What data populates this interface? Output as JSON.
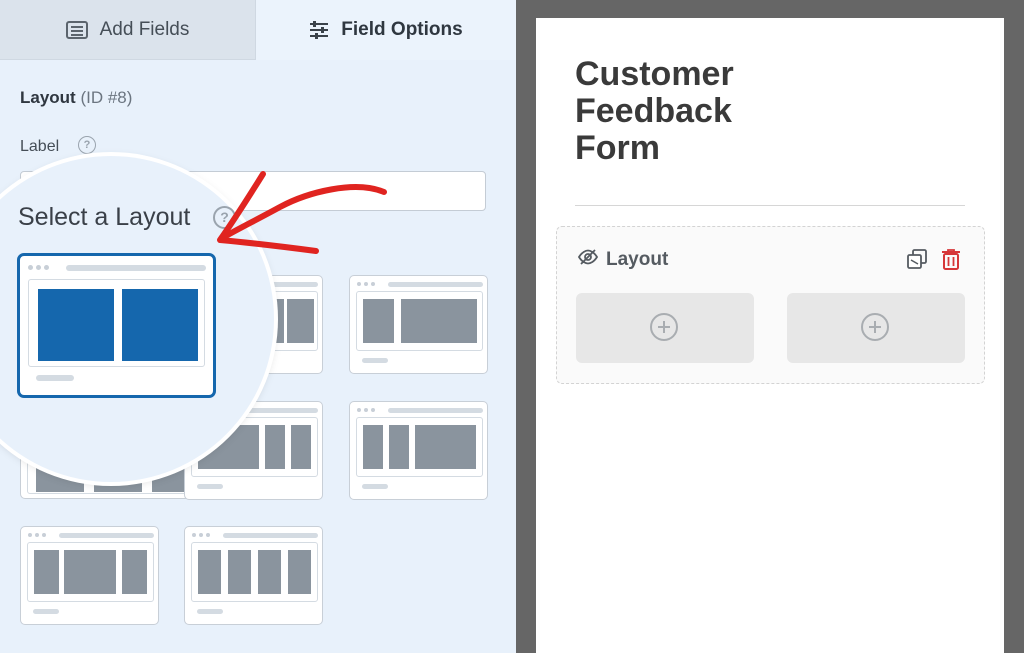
{
  "tabs": {
    "add_fields": "Add Fields",
    "field_options": "Field Options"
  },
  "field_options": {
    "title": "Layout",
    "id_text": "(ID #8)",
    "label": "Label",
    "help_icon": "?",
    "label_value": "",
    "select_layout": "Select a Layout",
    "selected_layout": "two equal columns"
  },
  "form": {
    "title_line1": "Customer",
    "title_line2": "Feedback",
    "title_line3": "Form",
    "field_label": "Layout",
    "columns": 2
  },
  "colors": {
    "accent_blue": "#1567ad",
    "arrow_red": "#e02420",
    "delete_red": "#d63638",
    "panel_bg": "#e8f1fb",
    "canvas_bg": "#666666"
  },
  "icons": [
    "list-icon",
    "sliders-icon",
    "help-icon",
    "eye-slash-icon",
    "duplicate-icon",
    "trash-icon",
    "plus-circle-icon",
    "red-arrow"
  ]
}
